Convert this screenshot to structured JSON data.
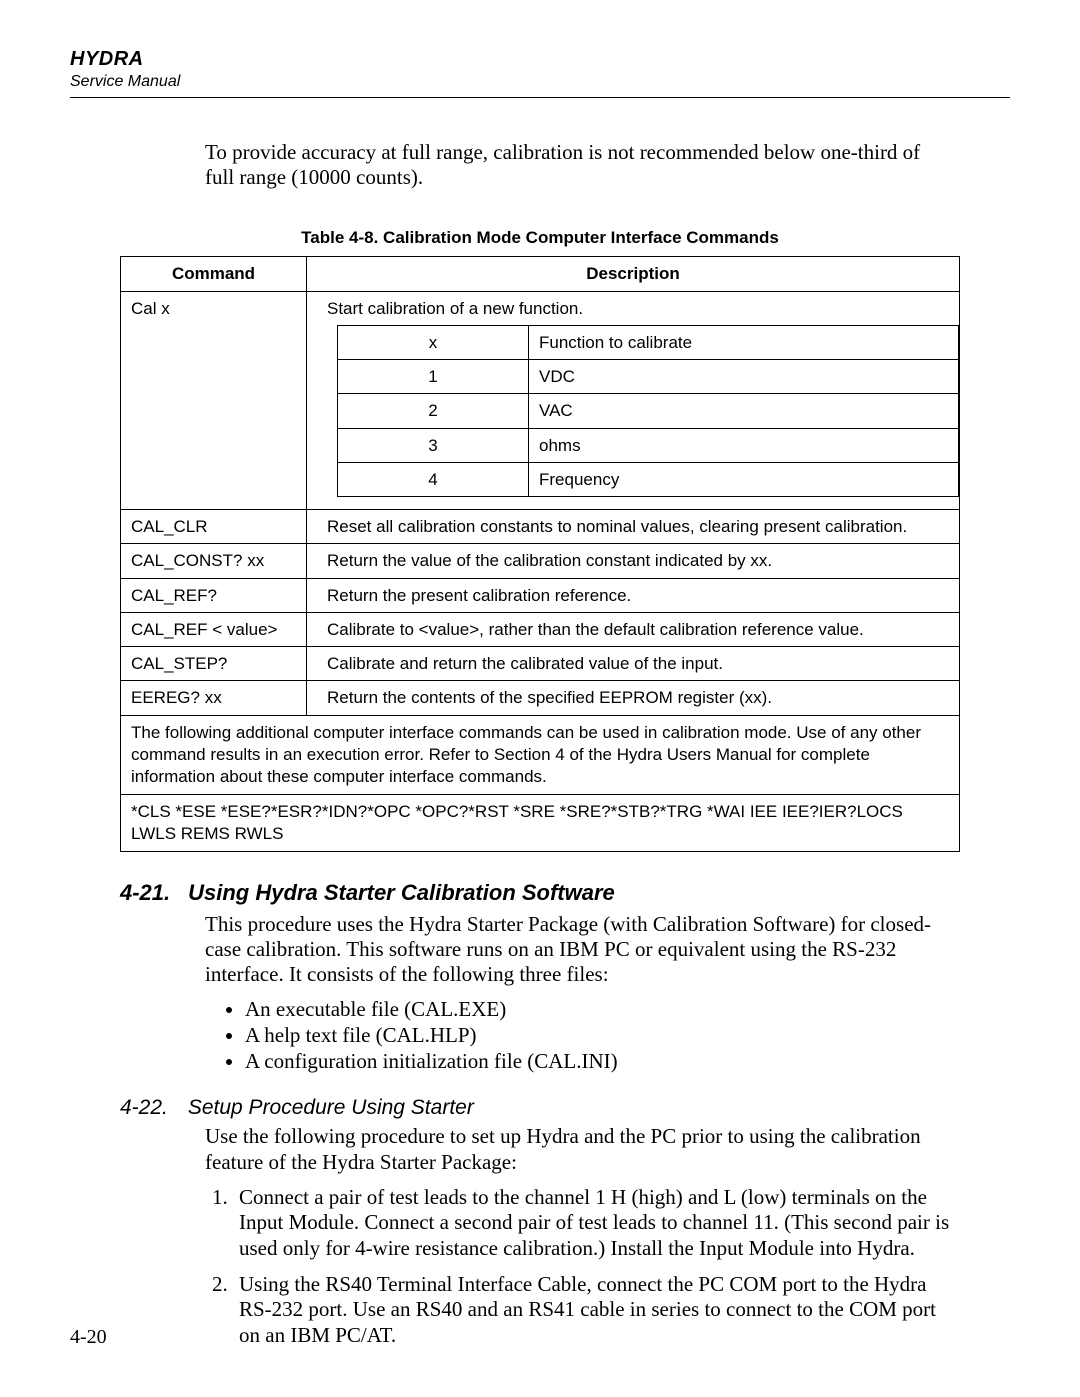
{
  "header": {
    "title": "HYDRA",
    "subtitle": "Service Manual"
  },
  "intro": "To provide accuracy at full range, calibration is not recommended below one-third of full range (10000 counts).",
  "table": {
    "caption": "Table 4-8. Calibration Mode Computer Interface Commands",
    "headers": {
      "command": "Command",
      "description": "Description"
    },
    "rows": {
      "calx": {
        "cmd": "Cal x",
        "desc_top": "Start calibration of a new function."
      },
      "inner_header": {
        "x": "x",
        "func": "Function to calibrate"
      },
      "inner": [
        {
          "x": "1",
          "func": "VDC"
        },
        {
          "x": "2",
          "func": "VAC"
        },
        {
          "x": "3",
          "func": "ohms"
        },
        {
          "x": "4",
          "func": "Frequency"
        }
      ],
      "cal_clr": {
        "cmd": "CAL_CLR",
        "desc": "Reset all calibration constants to nominal values, clearing present calibration."
      },
      "cal_const": {
        "cmd": "CAL_CONST? xx",
        "desc": "Return the value of the calibration constant indicated by xx."
      },
      "cal_refq": {
        "cmd": "CAL_REF?",
        "desc": "Return the present calibration reference."
      },
      "cal_refv": {
        "cmd": "CAL_REF < value>",
        "desc": "Calibrate to <value>, rather than the default calibration reference value."
      },
      "cal_step": {
        "cmd": "CAL_STEP?",
        "desc": "Calibrate and return the calibrated value of the input."
      },
      "eereg": {
        "cmd": "EEREG? xx",
        "desc": "Return the contents of the specified EEPROM register (xx)."
      }
    },
    "note1": "The following additional computer interface commands can be used in calibration mode. Use of any other command results in an execution error. Refer to Section 4 of the Hydra Users Manual for complete information about these computer interface commands.",
    "note2": "*CLS *ESE *ESE?*ESR?*IDN?*OPC *OPC?*RST *SRE *SRE?*STB?*TRG *WAI IEE IEE?IER?LOCS LWLS REMS RWLS"
  },
  "sec421": {
    "num": "4-21.",
    "title": "Using Hydra Starter Calibration Software",
    "body": "This procedure uses the Hydra Starter Package (with Calibration Software) for closed-case calibration. This software runs on an IBM PC or equivalent using the RS-232 interface. It consists of the following three files:",
    "files": [
      "An executable file (CAL.EXE)",
      "A help text file (CAL.HLP)",
      "A configuration initialization file (CAL.INI)"
    ]
  },
  "sec422": {
    "num": "4-22.",
    "title": "Setup Procedure Using Starter",
    "body": "Use the following procedure to set up Hydra and the PC prior to using the calibration feature of the Hydra Starter Package:",
    "steps": [
      "Connect a pair of test leads to the channel 1 H (high) and L (low) terminals on the Input Module. Connect a second pair of test leads to channel 11. (This second pair is used only for 4-wire resistance calibration.) Install the Input Module into Hydra.",
      "Using the RS40 Terminal Interface Cable, connect the PC COM port to the Hydra RS-232 port. Use an RS40 and an RS41 cable in series to connect to the COM port on an IBM PC/AT."
    ]
  },
  "page_number": "4-20"
}
